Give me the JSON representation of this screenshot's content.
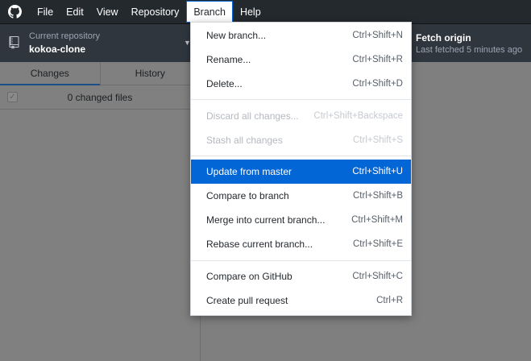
{
  "menubar": {
    "items": [
      "File",
      "Edit",
      "View",
      "Repository",
      "Branch",
      "Help"
    ],
    "open_item": "Branch"
  },
  "toolbar": {
    "repo_label": "Current repository",
    "repo_name": "kokoa-clone",
    "fetch_title": "Fetch origin",
    "fetch_sub": "Last fetched 5 minutes ago"
  },
  "sidebar": {
    "tabs": [
      "Changes",
      "History"
    ],
    "active_tab": "Changes",
    "changes_text": "0 changed files"
  },
  "branch_menu": {
    "items": [
      {
        "label": "New branch...",
        "shortcut": "Ctrl+Shift+N",
        "enabled": true
      },
      {
        "label": "Rename...",
        "shortcut": "Ctrl+Shift+R",
        "enabled": true
      },
      {
        "label": "Delete...",
        "shortcut": "Ctrl+Shift+D",
        "enabled": true
      },
      {
        "label": "Discard all changes...",
        "shortcut": "Ctrl+Shift+Backspace",
        "enabled": false
      },
      {
        "label": "Stash all changes",
        "shortcut": "Ctrl+Shift+S",
        "enabled": false
      },
      {
        "label": "Update from master",
        "shortcut": "Ctrl+Shift+U",
        "enabled": true,
        "highlighted": true
      },
      {
        "label": "Compare to branch",
        "shortcut": "Ctrl+Shift+B",
        "enabled": true
      },
      {
        "label": "Merge into current branch...",
        "shortcut": "Ctrl+Shift+M",
        "enabled": true
      },
      {
        "label": "Rebase current branch...",
        "shortcut": "Ctrl+Shift+E",
        "enabled": true
      },
      {
        "label": "Compare on GitHub",
        "shortcut": "Ctrl+Shift+C",
        "enabled": true
      },
      {
        "label": "Create pull request",
        "shortcut": "Ctrl+R",
        "enabled": true
      }
    ]
  },
  "colors": {
    "accent": "#0366d6",
    "titlebar": "#24292e"
  }
}
